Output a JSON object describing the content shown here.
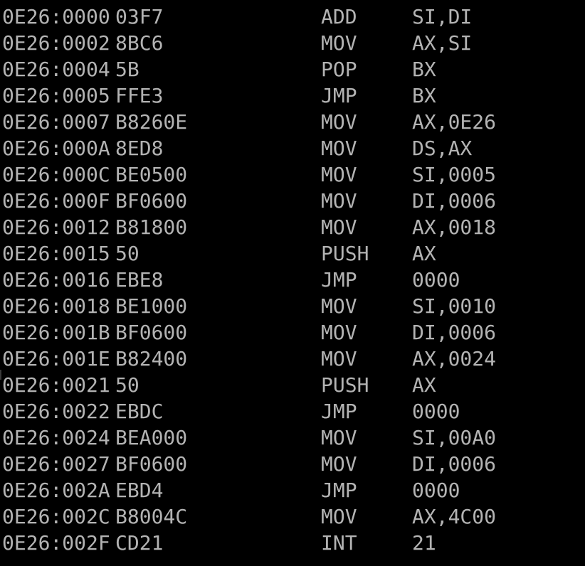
{
  "console": {
    "colors": {
      "background": "#000000",
      "text": "#b3b3b3"
    },
    "lines": [
      {
        "address": "0E26:0000",
        "bytes": "03F7",
        "mnemonic": "ADD",
        "operands": "SI,DI"
      },
      {
        "address": "0E26:0002",
        "bytes": "8BC6",
        "mnemonic": "MOV",
        "operands": "AX,SI"
      },
      {
        "address": "0E26:0004",
        "bytes": "5B",
        "mnemonic": "POP",
        "operands": "BX"
      },
      {
        "address": "0E26:0005",
        "bytes": "FFE3",
        "mnemonic": "JMP",
        "operands": "BX"
      },
      {
        "address": "0E26:0007",
        "bytes": "B8260E",
        "mnemonic": "MOV",
        "operands": "AX,0E26"
      },
      {
        "address": "0E26:000A",
        "bytes": "8ED8",
        "mnemonic": "MOV",
        "operands": "DS,AX"
      },
      {
        "address": "0E26:000C",
        "bytes": "BE0500",
        "mnemonic": "MOV",
        "operands": "SI,0005"
      },
      {
        "address": "0E26:000F",
        "bytes": "BF0600",
        "mnemonic": "MOV",
        "operands": "DI,0006"
      },
      {
        "address": "0E26:0012",
        "bytes": "B81800",
        "mnemonic": "MOV",
        "operands": "AX,0018"
      },
      {
        "address": "0E26:0015",
        "bytes": "50",
        "mnemonic": "PUSH",
        "operands": "AX"
      },
      {
        "address": "0E26:0016",
        "bytes": "EBE8",
        "mnemonic": "JMP",
        "operands": "0000"
      },
      {
        "address": "0E26:0018",
        "bytes": "BE1000",
        "mnemonic": "MOV",
        "operands": "SI,0010"
      },
      {
        "address": "0E26:001B",
        "bytes": "BF0600",
        "mnemonic": "MOV",
        "operands": "DI,0006"
      },
      {
        "address": "0E26:001E",
        "bytes": "B82400",
        "mnemonic": "MOV",
        "operands": "AX,0024"
      },
      {
        "address": "0E26:0021",
        "bytes": "50",
        "mnemonic": "PUSH",
        "operands": "AX"
      },
      {
        "address": "0E26:0022",
        "bytes": "EBDC",
        "mnemonic": "JMP",
        "operands": "0000"
      },
      {
        "address": "0E26:0024",
        "bytes": "BEA000",
        "mnemonic": "MOV",
        "operands": "SI,00A0"
      },
      {
        "address": "0E26:0027",
        "bytes": "BF0600",
        "mnemonic": "MOV",
        "operands": "DI,0006"
      },
      {
        "address": "0E26:002A",
        "bytes": "EBD4",
        "mnemonic": "JMP",
        "operands": "0000"
      },
      {
        "address": "0E26:002C",
        "bytes": "B8004C",
        "mnemonic": "MOV",
        "operands": "AX,4C00"
      },
      {
        "address": "0E26:002F",
        "bytes": "CD21",
        "mnemonic": "INT",
        "operands": "21"
      }
    ]
  }
}
